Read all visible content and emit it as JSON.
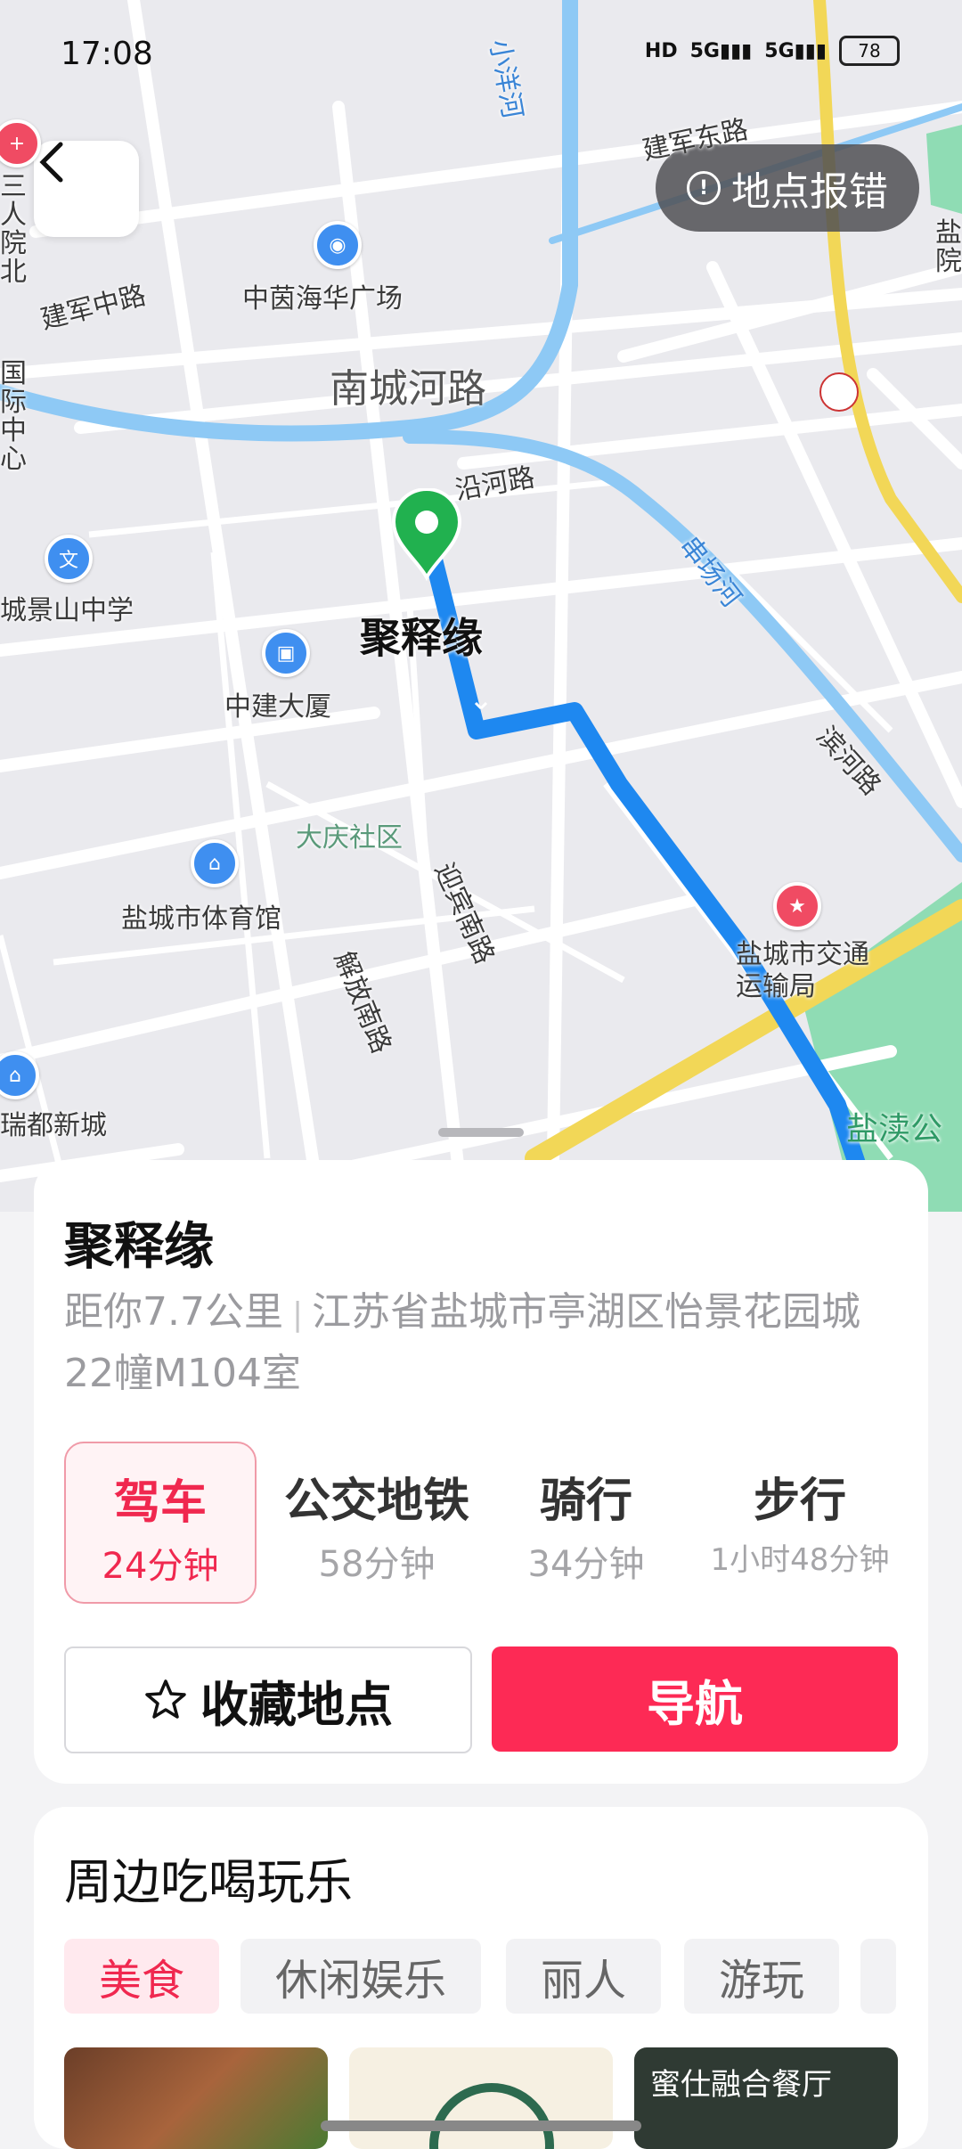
{
  "status_bar": {
    "time": "17:08",
    "network_1": "5G",
    "network_2": "5G",
    "hd": "HD",
    "battery": "78"
  },
  "map": {
    "report_label": "地点报错",
    "labels": {
      "jianjun_east_road": "建军东路",
      "jianjun_middle_road": "建军中路",
      "xiaoyang_river": "小洋河",
      "zhongyin_plaza": "中茵海华广场",
      "nancheng_river_road": "南城河路",
      "yanhe_road": "沿河路",
      "chuanchang_river": "串场河",
      "jingshan_school": "城景山中学",
      "destination": "聚释缘",
      "zhongjian_building": "中建大厦",
      "binhe_road": "滨河路",
      "daqing_community": "大庆社区",
      "yingbin_road": "迎宾南路",
      "sports_center": "盐城市体育馆",
      "jiefang_south_road": "解放南路",
      "transport_bureau": "盐城市交通运输局",
      "ruidu_new_city": "瑞都新城",
      "yandu_park": "盐渎公",
      "guoji_center": "国际中心",
      "sanren_hospital": "三人院北",
      "yancheng_right": "盐院"
    }
  },
  "place": {
    "name": "聚释缘",
    "distance": "距你7.7公里",
    "address": "江苏省盐城市亭湖区怡景花园城22幢M104室"
  },
  "modes": [
    {
      "label": "驾车",
      "time": "24分钟"
    },
    {
      "label": "公交地铁",
      "time": "58分钟"
    },
    {
      "label": "骑行",
      "time": "34分钟"
    },
    {
      "label": "步行",
      "time": "1小时48分钟"
    }
  ],
  "actions": {
    "favorite": "收藏地点",
    "navigate": "导航"
  },
  "nearby": {
    "title": "周边吃喝玩乐",
    "chips": [
      "美食",
      "休闲娱乐",
      "丽人",
      "游玩"
    ],
    "thumb_caption": "蜜仕融合餐厅"
  },
  "colors": {
    "accent": "#fd2a55",
    "route": "#1e88f0",
    "pin": "#21b14f"
  }
}
